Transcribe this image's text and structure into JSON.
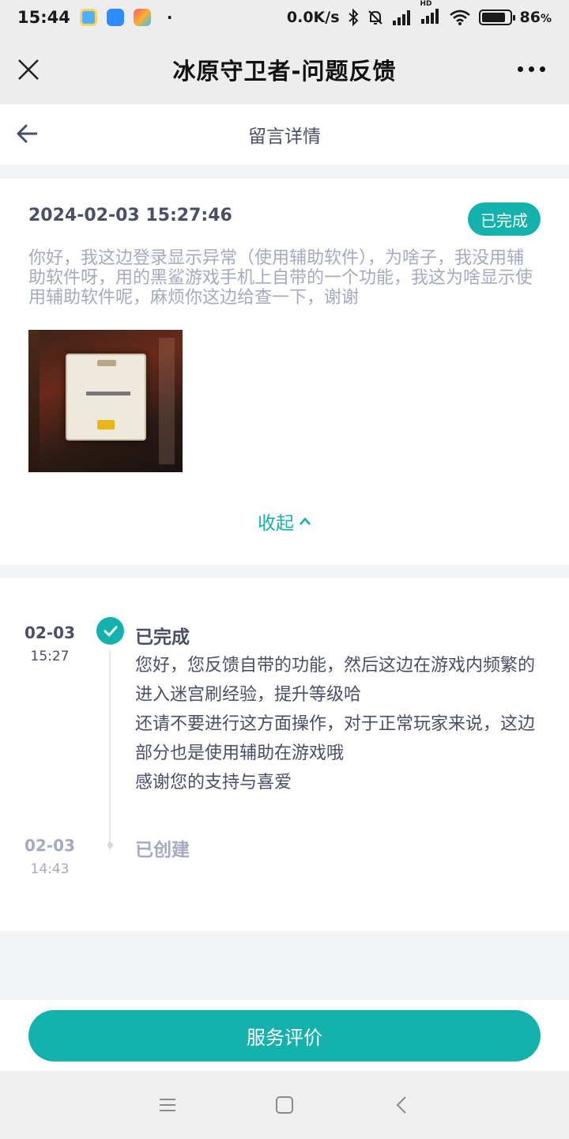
{
  "status_bar": {
    "time": "15:44",
    "dot": "·",
    "net_speed": "0.0K/s",
    "hd_label": "HD",
    "battery_percent": "86",
    "battery_level": 0.86
  },
  "window": {
    "title": "冰原守卫者-问题反馈"
  },
  "header": {
    "title": "留言详情"
  },
  "message": {
    "datetime": "2024-02-03 15:27:46",
    "status": "已完成",
    "text": "你好，我这边登录显示异常（使用辅助软件），为啥子，我没用辅助软件呀，用的黑鲨游戏手机上自带的一个功能，我这为啥显示使用辅助软件呢，麻烦你这边给查一下，谢谢",
    "collapse_label": "收起"
  },
  "timeline": [
    {
      "date": "02-03",
      "time": "15:27",
      "status": "已完成",
      "reply": [
        "您好，您反馈自带的功能，然后这边在游戏内频繁的进入迷宫刷经验，提升等级哈",
        "还请不要进行这方面操作，对于正常玩家来说，这边部分也是使用辅助在游戏哦",
        "感谢您的支持与喜爱"
      ]
    },
    {
      "date": "02-03",
      "time": "14:43",
      "status": "已创建"
    }
  ],
  "footer": {
    "rate_button": "服务评价"
  },
  "colors": {
    "accent": "#14b1ad",
    "muted_text": "#a6aabf",
    "primary_text": "#4a4e66"
  },
  "icons": {
    "close": "close-icon",
    "more": "more-icon",
    "back": "back-arrow-icon",
    "chevron_up": "chevron-up-icon",
    "check": "check-icon"
  }
}
